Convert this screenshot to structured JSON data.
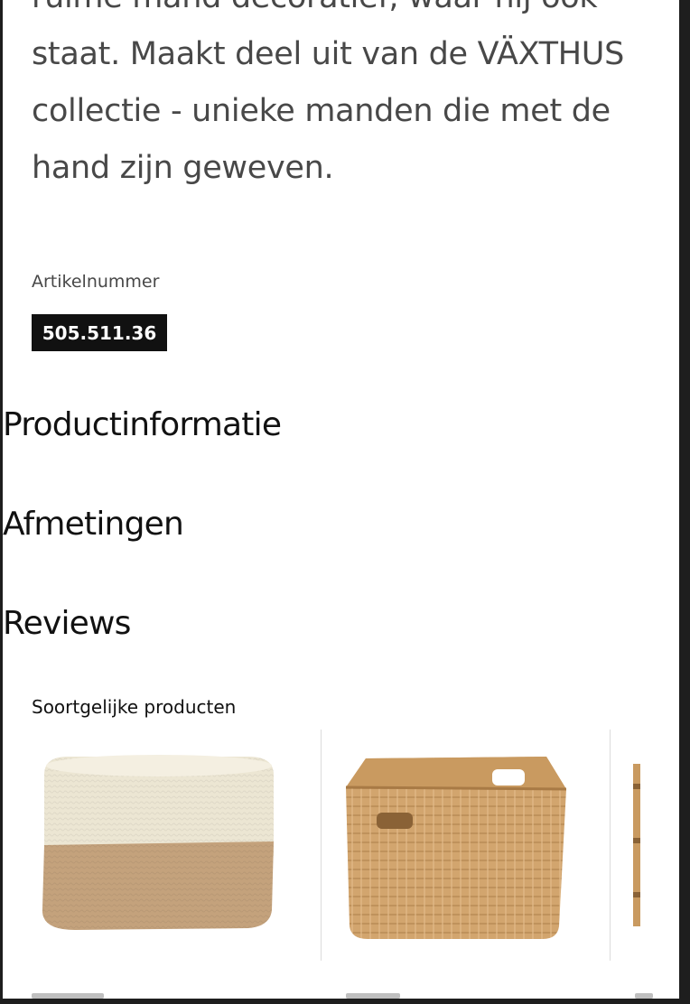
{
  "product": {
    "description": "ruime mand decoratief, waar hij ook staat. Maakt deel uit van de VÄXTHUS collectie - unieke manden die met de hand zijn geweven.",
    "article_label": "Artikelnummer",
    "article_number": "505.511.36"
  },
  "sections": [
    {
      "label": "Productinformatie"
    },
    {
      "label": "Afmetingen"
    },
    {
      "label": "Reviews"
    }
  ],
  "similar": {
    "title": "Soortgelijke producten"
  },
  "colors": {
    "basket_cream": "#ece6d3",
    "basket_tan": "#c4a27c",
    "wicker": "#d2a56e"
  }
}
